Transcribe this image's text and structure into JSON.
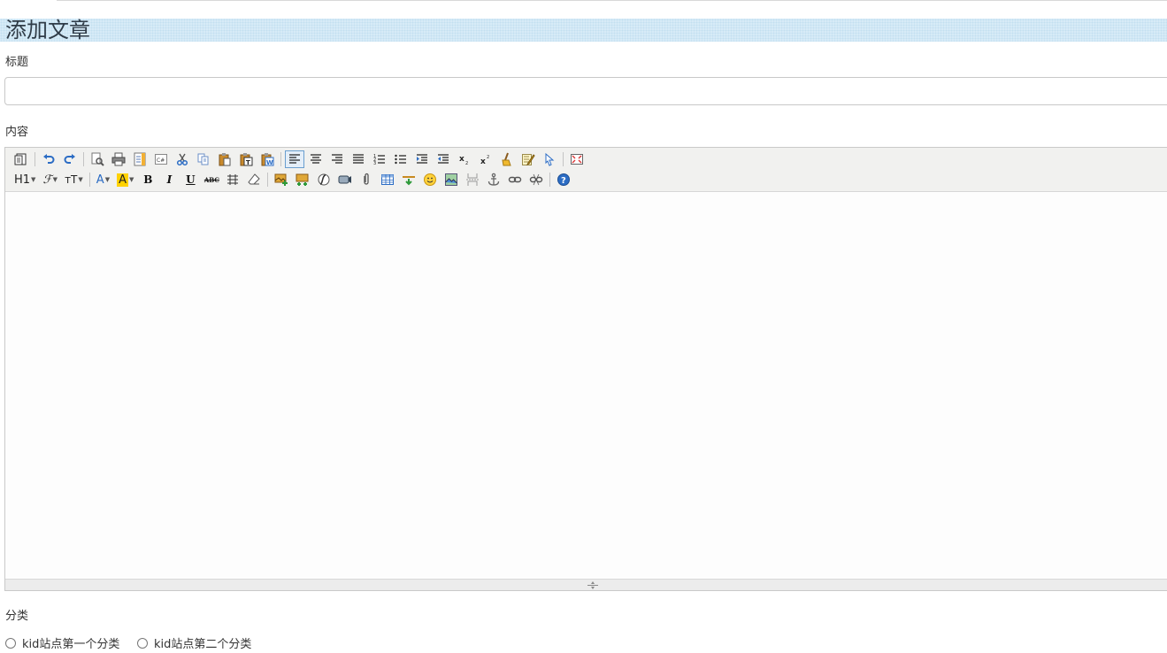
{
  "page": {
    "title": "添加文章",
    "title_label": "标题",
    "title_value": "",
    "content_label": "内容",
    "category_label": "分类"
  },
  "editor": {
    "toolbar_row1": [
      "source",
      "undo",
      "redo",
      "preview",
      "print",
      "template",
      "code",
      "cut",
      "copy",
      "paste",
      "paste-text",
      "paste-word",
      "justify-left",
      "justify-center",
      "justify-right",
      "justify-full",
      "ordered-list",
      "unordered-list",
      "indent",
      "outdent",
      "subscript",
      "superscript",
      "clear-html",
      "quick-format",
      "select-all",
      "fullscreen"
    ],
    "toolbar_row2": [
      "formatblock",
      "fontname",
      "fontsize",
      "forecolor",
      "hilitecolor",
      "bold",
      "italic",
      "underline",
      "strikethrough",
      "line-height",
      "remove-format",
      "image",
      "multi-image",
      "flash",
      "media",
      "insert-file",
      "table",
      "horizontal-rule",
      "emoticons",
      "baidu-map",
      "page-break",
      "anchor",
      "link",
      "unlink",
      "about"
    ],
    "heading_label": "H1",
    "fontname_label": "ℱ",
    "fontsize_label": "тT",
    "forecolor_label": "A",
    "hilitecolor_label": "A",
    "bold_label": "B",
    "italic_label": "I",
    "underline_label": "U",
    "strike_label": "ABC",
    "active_alignment": "justify-left",
    "content": ""
  },
  "categories": [
    {
      "label": "kid站点第一个分类",
      "checked": false
    },
    {
      "label": "kid站点第二个分类",
      "checked": false
    }
  ],
  "colors": {
    "header_band": "#d7ebf7",
    "toolbar_bg": "#f1f1ef",
    "accent_blue": "#2b6cc4",
    "highlight_yellow": "#ffd200"
  }
}
